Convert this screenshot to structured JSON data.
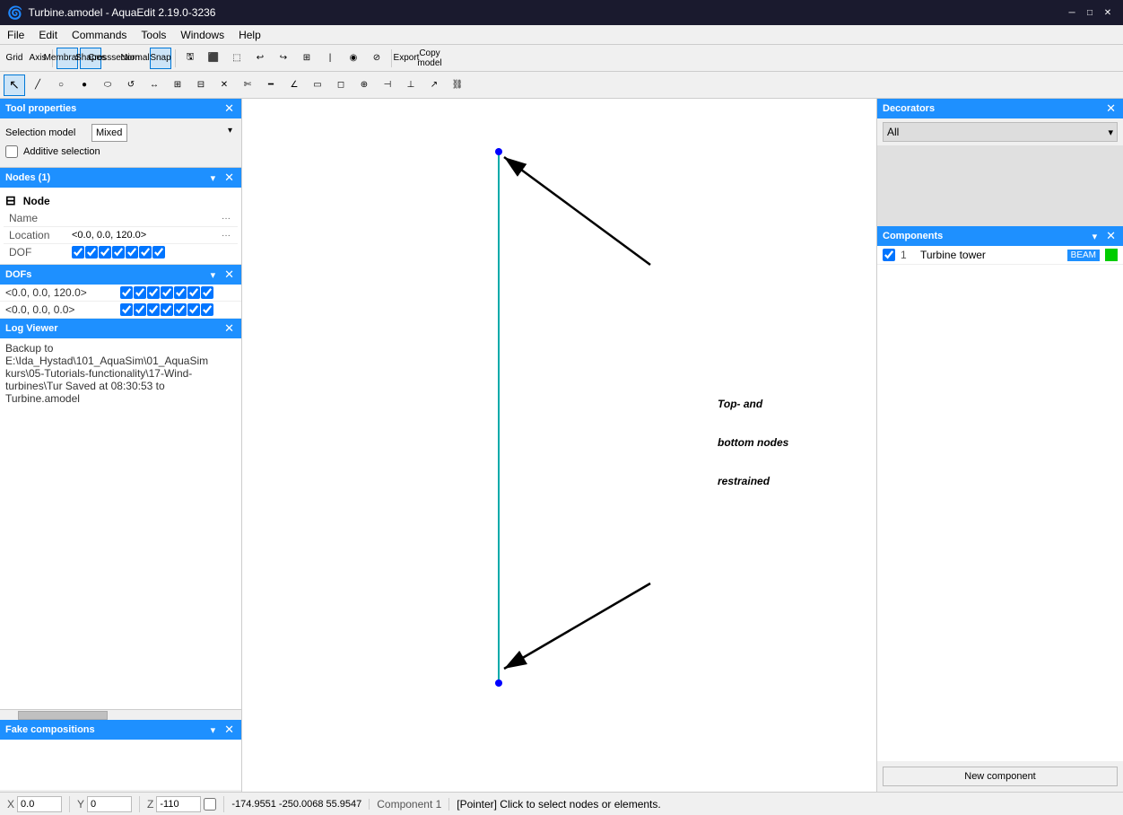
{
  "titlebar": {
    "icon": "turbine-icon",
    "title": "Turbine.amodel - AquaEdit 2.19.0-3236",
    "minimize": "─",
    "maximize": "□",
    "close": "✕"
  },
  "menubar": {
    "items": [
      "File",
      "Edit",
      "Commands",
      "Tools",
      "Windows",
      "Help"
    ]
  },
  "toolbar1": {
    "buttons": [
      "Grid",
      "Axis"
    ],
    "mode_buttons": [
      "Membranes",
      "Shapes",
      "Crosssection",
      "Normals",
      "Snap"
    ],
    "extra": [
      "Export",
      "Copy model"
    ]
  },
  "tool_properties": {
    "title": "Tool properties",
    "selection_model_label": "Selection model",
    "selection_model_value": "Mixed",
    "additive_selection_label": "Additive selection"
  },
  "nodes_panel": {
    "title": "Nodes (1)",
    "node_label": "Node",
    "name_label": "Name",
    "name_value": "",
    "location_label": "Location",
    "location_value": "<0.0, 0.0, 120.0>",
    "dof_label": "DOF"
  },
  "dofs_panel": {
    "title": "DOFs",
    "rows": [
      "<0.0, 0.0, 120.0>",
      "<0.0, 0.0, 0.0>"
    ]
  },
  "log_panel": {
    "title": "Log Viewer",
    "content": "Backup to E:\\Ida_Hystad\\101_AquaSim\\01_AquaSim\nkurs\\05-Tutorials-functionality\\17-Wind-turbines\\Tur\nSaved at 08:30:53 to Turbine.amodel"
  },
  "fake_compositions": {
    "title": "Fake compositions"
  },
  "canvas": {
    "annotation": "Top- and\nbottom nodes\nrestrained"
  },
  "decorators_panel": {
    "title": "Decorators",
    "dropdown_value": "All"
  },
  "components_panel": {
    "title": "Components",
    "items": [
      {
        "checked": true,
        "num": "1",
        "name": "Turbine tower",
        "type": "BEAM",
        "color": "#00cc00"
      }
    ],
    "new_component_label": "New component"
  },
  "statusbar": {
    "x_label": "X",
    "x_value": "0.0",
    "y_label": "Y",
    "y_value": "0",
    "z_label": "Z",
    "z_value": "-110",
    "coords": [
      "-174.9551",
      "-250.0068",
      "55.9547"
    ],
    "component_label": "Component 1",
    "status_text": "[Pointer] Click to select nodes or elements."
  }
}
